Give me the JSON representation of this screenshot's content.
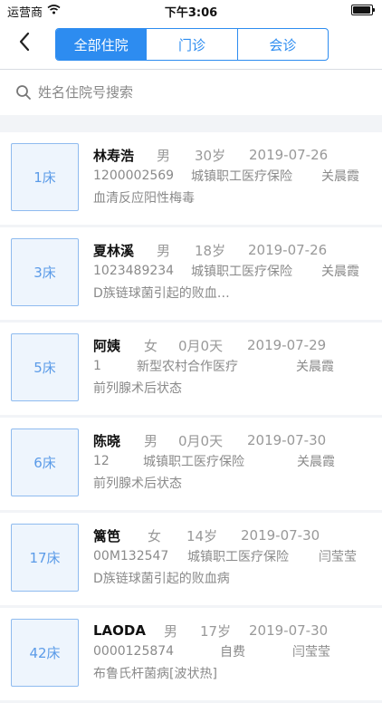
{
  "status_bar": {
    "carrier": "运营商",
    "time": "下午3:06"
  },
  "nav": {
    "tabs": [
      {
        "label": "全部住院",
        "active": true
      },
      {
        "label": "门诊",
        "active": false
      },
      {
        "label": "会诊",
        "active": false
      }
    ]
  },
  "search": {
    "placeholder": "姓名住院号搜索",
    "value": ""
  },
  "colors": {
    "accent": "#2d8cf0",
    "bed_text": "#5b9be8",
    "bed_bg": "#eef5fd"
  },
  "patients": [
    {
      "bed": "1床",
      "name": "林寿浩",
      "gender": "男",
      "age": "30岁",
      "date": "2019-07-26",
      "id": "1200002569",
      "insurance": "城镇职工医疗保险",
      "doctor": "关晨霞",
      "diagnosis": "血清反应阳性梅毒"
    },
    {
      "bed": "3床",
      "name": "夏林溪",
      "gender": "男",
      "age": "18岁",
      "date": "2019-07-26",
      "id": "1023489234",
      "insurance": "城镇职工医疗保险",
      "doctor": "关晨霞",
      "diagnosis": "D族链球菌引起的败血…"
    },
    {
      "bed": "5床",
      "name": "阿姨",
      "gender": "女",
      "age": "0月0天",
      "date": "2019-07-29",
      "id": "1",
      "insurance": "新型农村合作医疗",
      "doctor": "关晨霞",
      "diagnosis": "前列腺术后状态"
    },
    {
      "bed": "6床",
      "name": "陈晓",
      "gender": "男",
      "age": "0月0天",
      "date": "2019-07-30",
      "id": "12",
      "insurance": "城镇职工医疗保险",
      "doctor": "关晨霞",
      "diagnosis": "前列腺术后状态"
    },
    {
      "bed": "17床",
      "name": "篱笆",
      "gender": "女",
      "age": "14岁",
      "date": "2019-07-30",
      "id": "00M132547",
      "insurance": "城镇职工医疗保险",
      "doctor": "闫莹莹",
      "diagnosis": "D族链球菌引起的败血病"
    },
    {
      "bed": "42床",
      "name": "LAODA",
      "gender": "男",
      "age": "17岁",
      "date": "2019-07-30",
      "id": "0000125874",
      "insurance": "自费",
      "doctor": "闫莹莹",
      "diagnosis": "布鲁氏杆菌病[波状热]"
    }
  ]
}
